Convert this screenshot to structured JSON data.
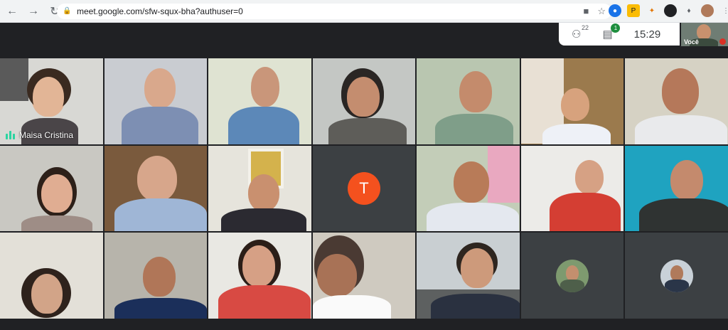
{
  "browser": {
    "url": "meet.google.com/sfw-squx-bha?authuser=0",
    "back_icon": "arrow-left",
    "forward_icon": "arrow-right",
    "reload_icon": "reload"
  },
  "meet": {
    "participants_count": "22",
    "chat_unread": "1",
    "time": "15:29",
    "self_label": "Você"
  },
  "tiles": {
    "speaker_name": "Maisa Cristina",
    "avatar_letter": "T"
  }
}
